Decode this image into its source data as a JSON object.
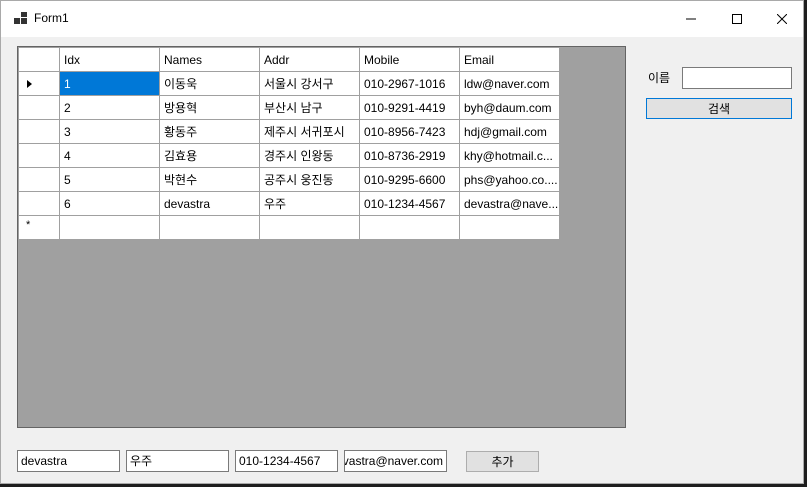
{
  "window": {
    "title": "Form1"
  },
  "grid": {
    "columns": [
      "Idx",
      "Names",
      "Addr",
      "Mobile",
      "Email"
    ],
    "rows": [
      [
        "1",
        "이동욱",
        "서울시 강서구",
        "010-2967-1016",
        "ldw@naver.com"
      ],
      [
        "2",
        "방용혁",
        "부산시 남구",
        "010-9291-4419",
        "byh@daum.com"
      ],
      [
        "3",
        "황동주",
        "제주시 서귀포시",
        "010-8956-7423",
        "hdj@gmail.com"
      ],
      [
        "4",
        "김효용",
        "경주시 인왕동",
        "010-8736-2919",
        "khy@hotmail.c..."
      ],
      [
        "5",
        "박현수",
        "공주시 웅진동",
        "010-9295-6600",
        "phs@yahoo.co...."
      ],
      [
        "6",
        "devastra",
        "우주",
        "010-1234-4567",
        "devastra@nave..."
      ]
    ],
    "new_row_marker": "*"
  },
  "search": {
    "label": "이름",
    "value": "",
    "button_label": "검색"
  },
  "form": {
    "name_value": "devastra",
    "addr_value": "우주",
    "mobile_value": "010-1234-4567",
    "email_value": "devastra@naver.com",
    "add_button_label": "추가"
  },
  "colors": {
    "selection": "#0078d7",
    "grid_background": "#a0a0a0"
  }
}
